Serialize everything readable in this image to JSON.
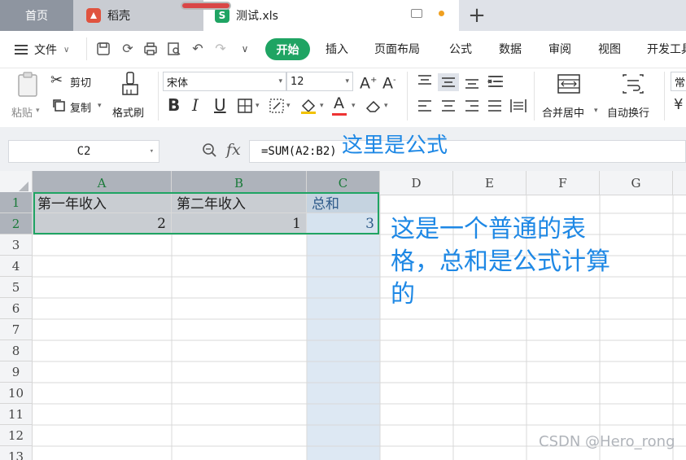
{
  "tabs": {
    "home": "首页",
    "daoke": "稻壳",
    "file": "测试.xls"
  },
  "menu": {
    "file": "文件",
    "start": "开始",
    "items": [
      "插入",
      "页面布局",
      "公式",
      "数据",
      "审阅",
      "视图",
      "开发工具"
    ]
  },
  "ribbon": {
    "paste": "粘贴",
    "cut": "剪切",
    "copy": "复制",
    "format_painter": "格式刷",
    "font_name": "宋体",
    "font_size": "12",
    "merge_center": "合并居中",
    "wrap_text": "自动换行",
    "number_format": "常"
  },
  "formula_bar": {
    "name_box": "C2",
    "fx_label": "fx",
    "formula": "=SUM(A2:B2)"
  },
  "annotations": {
    "formula_note": "这里是公式",
    "table_note": "这是一个普通的表格，总和是公式计算的"
  },
  "sheet": {
    "columns": [
      "A",
      "B",
      "C",
      "D",
      "E",
      "F",
      "G"
    ],
    "rows": [
      "1",
      "2",
      "3",
      "4",
      "5",
      "6",
      "7",
      "8",
      "9",
      "10",
      "11",
      "12",
      "13"
    ],
    "cells": {
      "A1": "第一年收入",
      "B1": "第二年收入",
      "C1": "总和",
      "A2": "2",
      "B2": "1",
      "C2": "3"
    }
  },
  "watermark": "CSDN @Hero_rong",
  "colors": {
    "accent_green": "#1fa463",
    "annotation_blue": "#1e88e5"
  }
}
